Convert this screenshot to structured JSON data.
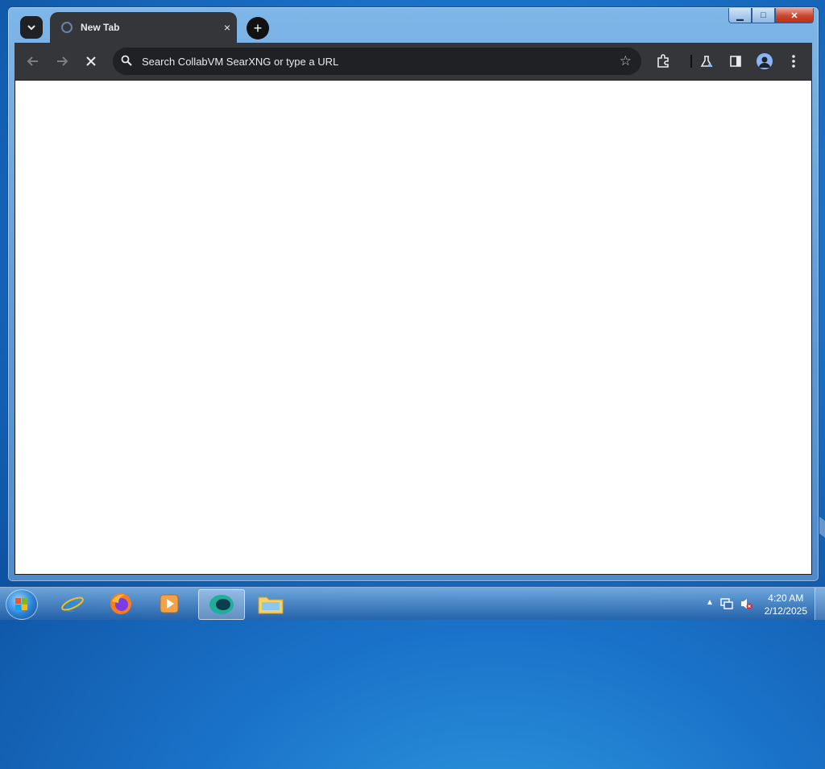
{
  "browser": {
    "tab": {
      "title": "New Tab",
      "close_label": "×"
    },
    "new_tab_label": "+",
    "omnibox": {
      "placeholder": "Search CollabVM SearXNG or type a URL"
    }
  },
  "window_controls": {
    "minimize": "▁",
    "maximize": "□",
    "close": "✕"
  },
  "taskbar": {
    "apps": [
      "internet-explorer",
      "firefox",
      "media-player",
      "browser",
      "file-explorer"
    ],
    "clock": {
      "time": "4:20 AM",
      "date": "2/12/2025"
    }
  },
  "colors": {
    "toolbar": "#35363a",
    "tabstrip": "#202124",
    "accent": "#8ab4f8"
  }
}
